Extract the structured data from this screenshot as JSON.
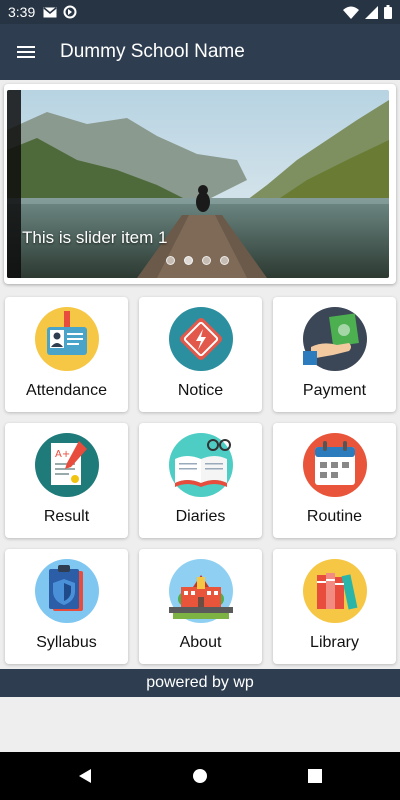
{
  "status_bar": {
    "time": "3:39",
    "left_icons": [
      "gmail-icon",
      "sync-icon"
    ],
    "right_icons": [
      "wifi-icon",
      "signal-icon",
      "battery-icon"
    ]
  },
  "app_bar": {
    "title": "Dummy School Name",
    "menu_icon": "menu-icon"
  },
  "slider": {
    "caption": "This is slider item 1",
    "dot_count": 4,
    "active_index": 1
  },
  "menu": {
    "items": [
      {
        "label": "Attendance",
        "icon": "id-card-icon"
      },
      {
        "label": "Notice",
        "icon": "warning-diamond-icon"
      },
      {
        "label": "Payment",
        "icon": "payment-hand-icon"
      },
      {
        "label": "Result",
        "icon": "exam-result-icon"
      },
      {
        "label": "Diaries",
        "icon": "open-book-icon"
      },
      {
        "label": "Routine",
        "icon": "calendar-icon"
      },
      {
        "label": "Syllabus",
        "icon": "clipboard-shield-icon"
      },
      {
        "label": "About",
        "icon": "school-building-icon"
      },
      {
        "label": "Library",
        "icon": "books-icon"
      }
    ]
  },
  "footer": {
    "text": "powered by wp"
  },
  "colors": {
    "status_bar": "#263444",
    "app_bar": "#2e3e50",
    "background": "#eeeeee",
    "tile": "#ffffff"
  }
}
